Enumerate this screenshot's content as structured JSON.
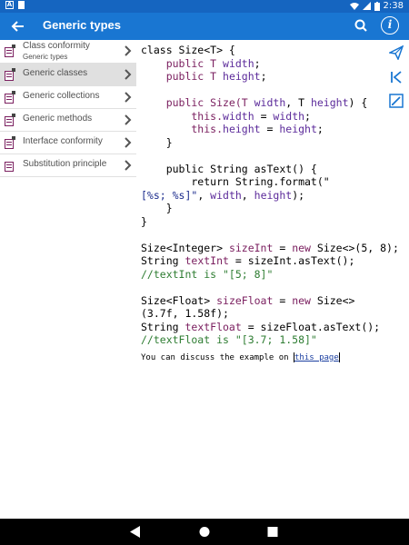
{
  "status_bar": {
    "time": "2:38"
  },
  "app_bar": {
    "title": "Generic types"
  },
  "sidebar": {
    "items": [
      {
        "label": "Class conformity",
        "subtitle": "Generic types",
        "active": false
      },
      {
        "label": "Generic classes",
        "active": true
      },
      {
        "label": "Generic collections",
        "active": false
      },
      {
        "label": "Generic methods",
        "active": false
      },
      {
        "label": "Interface conformity",
        "active": false
      },
      {
        "label": "Substitution principle",
        "active": false
      }
    ]
  },
  "code": {
    "lines": [
      [
        [
          "class Size<T> {",
          ""
        ]
      ],
      [
        [
          "    public T ",
          "kw"
        ],
        [
          "width",
          "fld"
        ],
        [
          ";",
          ""
        ]
      ],
      [
        [
          "    public T ",
          "kw"
        ],
        [
          "height",
          "fld"
        ],
        [
          ";",
          ""
        ]
      ],
      [
        [
          "",
          ""
        ]
      ],
      [
        [
          "    public Size(T ",
          "kw"
        ],
        [
          "width",
          "fld"
        ],
        [
          ", T ",
          ""
        ],
        [
          "height",
          "fld"
        ],
        [
          ") {",
          ""
        ]
      ],
      [
        [
          "        this.",
          "kw"
        ],
        [
          "width",
          "fld"
        ],
        [
          " = ",
          ""
        ],
        [
          "width",
          "fld"
        ],
        [
          ";",
          ""
        ]
      ],
      [
        [
          "        this.",
          "kw"
        ],
        [
          "height",
          "fld"
        ],
        [
          " = ",
          ""
        ],
        [
          "height",
          "fld"
        ],
        [
          ";",
          ""
        ]
      ],
      [
        [
          "    }",
          ""
        ]
      ],
      [
        [
          "",
          ""
        ]
      ],
      [
        [
          "    public String asText() {",
          ""
        ]
      ],
      [
        [
          "        return String.format(\"",
          ""
        ]
      ],
      [
        [
          "[%s; %s]\"",
          "str"
        ],
        [
          ", ",
          ""
        ],
        [
          "width",
          "fld"
        ],
        [
          ", ",
          ""
        ],
        [
          "height",
          "fld"
        ],
        [
          ");",
          ""
        ]
      ],
      [
        [
          "    }",
          ""
        ]
      ],
      [
        [
          "}",
          ""
        ]
      ],
      [
        [
          "",
          ""
        ]
      ],
      [
        [
          "Size<Integer> ",
          ""
        ],
        [
          "sizeInt",
          "var"
        ],
        [
          " = ",
          ""
        ],
        [
          "new",
          "kw"
        ],
        [
          " Size<>(5, 8);",
          ""
        ]
      ],
      [
        [
          "String ",
          ""
        ],
        [
          "textInt",
          "var"
        ],
        [
          " = sizeInt.asText();",
          ""
        ]
      ],
      [
        [
          "//textInt is \"[5; 8]\"",
          "cmt"
        ]
      ],
      [
        [
          "",
          ""
        ]
      ],
      [
        [
          "Size<Float> ",
          ""
        ],
        [
          "sizeFloat",
          "var"
        ],
        [
          " = ",
          ""
        ],
        [
          "new",
          "kw"
        ],
        [
          " Size<>",
          ""
        ]
      ],
      [
        [
          "(3.7f, 1.58f);",
          ""
        ]
      ],
      [
        [
          "String ",
          ""
        ],
        [
          "textFloat",
          "var"
        ],
        [
          " = sizeFloat.asText();",
          ""
        ]
      ],
      [
        [
          "//textFloat is \"[3.7; 1.58]\"",
          "cmt"
        ]
      ]
    ]
  },
  "footer": {
    "discuss_prefix": "You can discuss the example on ",
    "link_label": "this page"
  },
  "icons": {
    "back": "arrow-back-icon",
    "search": "search-icon",
    "info": "info-icon",
    "share": "send-icon",
    "first": "skip-first-icon",
    "edit": "edit-icon"
  },
  "colors": {
    "app_bar": "#1976d2",
    "status_bar": "#1565c0",
    "active_item": "#e0e0e0",
    "keyword": "#7b2060",
    "comment": "#2e7d32"
  }
}
